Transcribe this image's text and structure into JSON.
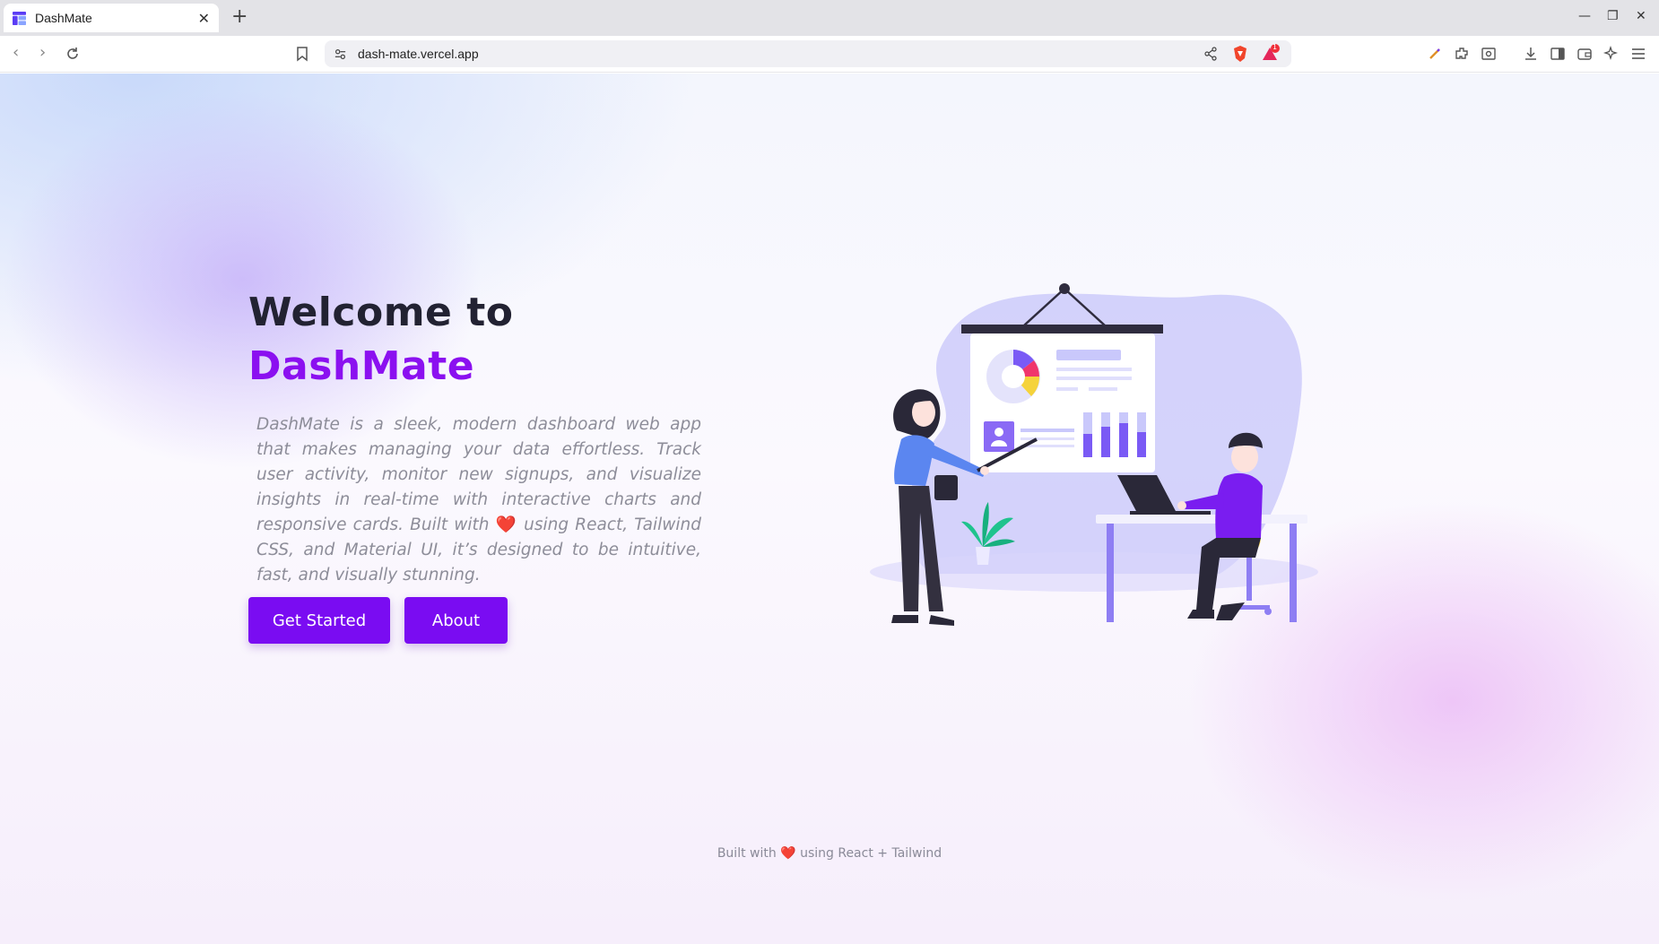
{
  "browser": {
    "tab_title": "DashMate",
    "url": "dash-mate.vercel.app",
    "notification_count": "1"
  },
  "hero": {
    "title_line1": "Welcome to",
    "title_line2": "DashMate",
    "description_part1": "DashMate is a sleek, modern dashboard web app that makes managing your data effortless. Track user activity, monitor new signups, and visualize insights in real-time with interactive charts and responsive cards. Built with",
    "description_heart": "❤️",
    "description_part2": "using React, Tailwind CSS, and Material UI, it’s designed to be intuitive, fast, and visually stunning.",
    "get_started_label": "Get Started",
    "about_label": "About"
  },
  "footer": {
    "part1": "Built with",
    "heart": "❤️",
    "part2": "using React + Tailwind"
  },
  "colors": {
    "accent": "#7a0cf2",
    "brand_title": "#8b10f0",
    "heading": "#222232"
  }
}
